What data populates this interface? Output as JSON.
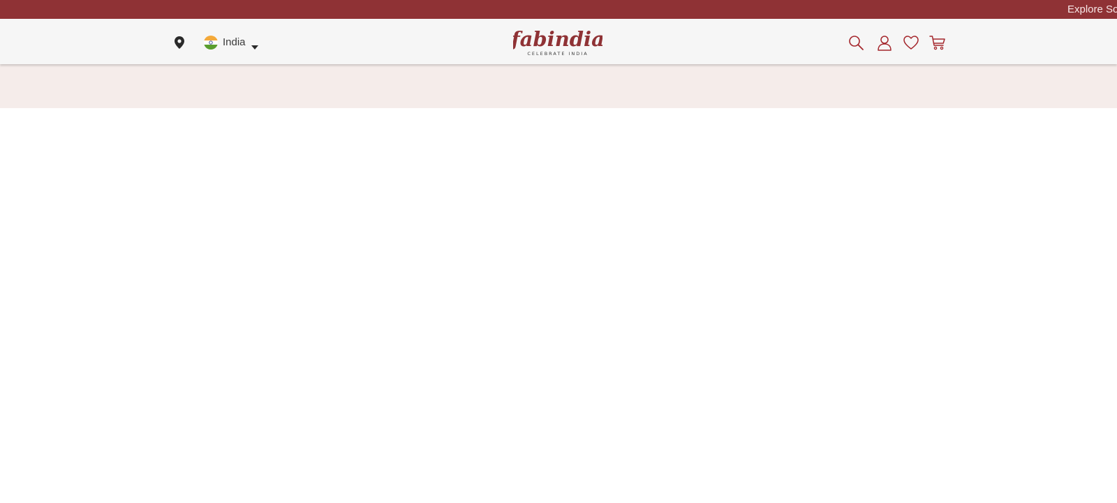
{
  "announcement": {
    "text": "Explore So"
  },
  "header": {
    "location_icon": "map-pin-icon",
    "country": {
      "label": "India",
      "flag_icon": "india-flag-icon",
      "dropdown_icon": "caret-down-icon"
    },
    "logo": {
      "brand": "fabindia",
      "tagline": "CELEBRATE INDIA"
    },
    "actions": [
      {
        "icon": "search-icon"
      },
      {
        "icon": "user-icon"
      },
      {
        "icon": "heart-icon"
      },
      {
        "icon": "cart-icon"
      }
    ]
  },
  "colors": {
    "brand": "#8f3235",
    "header_bg": "#f6f6f6",
    "banner_bg": "#f5ecea",
    "icon_color": "#a4262c"
  }
}
